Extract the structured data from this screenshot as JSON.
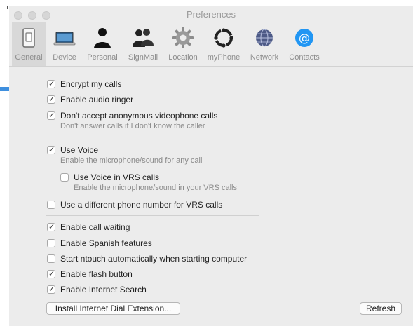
{
  "window": {
    "title": "Preferences"
  },
  "toolbar": {
    "items": [
      {
        "label": "General",
        "icon": "general-switch-icon",
        "selected": true
      },
      {
        "label": "Device",
        "icon": "laptop-icon"
      },
      {
        "label": "Personal",
        "icon": "person-icon"
      },
      {
        "label": "SignMail",
        "icon": "people-icon"
      },
      {
        "label": "Location",
        "icon": "gear-icon"
      },
      {
        "label": "myPhone",
        "icon": "circle-arrows-icon"
      },
      {
        "label": "Network",
        "icon": "globe-icon"
      },
      {
        "label": "Contacts",
        "icon": "at-sign-icon"
      }
    ]
  },
  "options": {
    "encrypt": {
      "label": "Encrypt my calls",
      "checked": true
    },
    "audio_ringer": {
      "label": "Enable audio ringer",
      "checked": true
    },
    "anonymous": {
      "label": "Don't accept anonymous videophone calls",
      "desc": "Don't answer calls if I don't know the caller",
      "checked": true
    },
    "use_voice": {
      "label": "Use Voice",
      "desc": "Enable the microphone/sound for any call",
      "checked": true
    },
    "voice_vrs": {
      "label": "Use Voice in VRS calls",
      "desc": "Enable the microphone/sound in your VRS calls",
      "checked": false
    },
    "diff_number": {
      "label": "Use a different phone number for VRS calls",
      "checked": false
    },
    "call_waiting": {
      "label": "Enable call waiting",
      "checked": true
    },
    "spanish": {
      "label": "Enable Spanish features",
      "checked": false
    },
    "auto_start": {
      "label": "Start ntouch automatically when starting computer",
      "checked": false
    },
    "flash": {
      "label": "Enable flash button",
      "checked": true
    },
    "internet_search": {
      "label": "Enable Internet Search",
      "checked": true
    }
  },
  "buttons": {
    "install": "Install Internet Dial Extension...",
    "refresh": "Refresh"
  },
  "colors": {
    "arrow": "#3f8fde",
    "contacts_icon": "#2196f3"
  }
}
